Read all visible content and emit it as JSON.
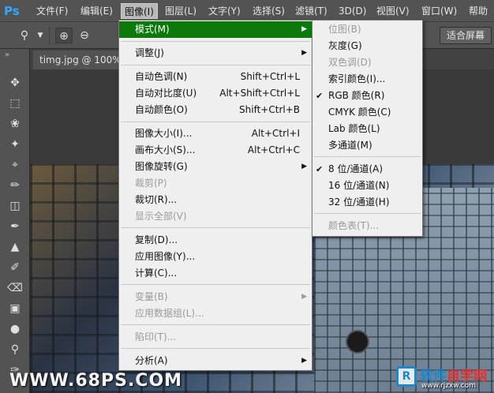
{
  "app": {
    "logo": "Ps"
  },
  "menubar": {
    "items": [
      "文件(F)",
      "编辑(E)",
      "图像(I)",
      "图层(L)",
      "文字(Y)",
      "选择(S)",
      "滤镜(T)",
      "3D(D)",
      "视图(V)",
      "窗口(W)",
      "帮助"
    ]
  },
  "options": {
    "fit_screen": "适合屏幕"
  },
  "document": {
    "tab_title": "timg.jpg @ 100%("
  },
  "image_menu": {
    "items": [
      {
        "label": "模式(M)",
        "shortcut": "",
        "submenu": true,
        "disabled": false
      },
      {
        "label": "调整(J)",
        "shortcut": "",
        "submenu": true,
        "disabled": false
      },
      {
        "label": "自动色调(N)",
        "shortcut": "Shift+Ctrl+L",
        "submenu": false,
        "disabled": false
      },
      {
        "label": "自动对比度(U)",
        "shortcut": "Alt+Shift+Ctrl+L",
        "submenu": false,
        "disabled": false
      },
      {
        "label": "自动颜色(O)",
        "shortcut": "Shift+Ctrl+B",
        "submenu": false,
        "disabled": false
      },
      {
        "label": "图像大小(I)...",
        "shortcut": "Alt+Ctrl+I",
        "submenu": false,
        "disabled": false
      },
      {
        "label": "画布大小(S)...",
        "shortcut": "Alt+Ctrl+C",
        "submenu": false,
        "disabled": false
      },
      {
        "label": "图像旋转(G)",
        "shortcut": "",
        "submenu": true,
        "disabled": false
      },
      {
        "label": "裁剪(P)",
        "shortcut": "",
        "submenu": false,
        "disabled": true
      },
      {
        "label": "裁切(R)...",
        "shortcut": "",
        "submenu": false,
        "disabled": false
      },
      {
        "label": "显示全部(V)",
        "shortcut": "",
        "submenu": false,
        "disabled": true
      },
      {
        "label": "复制(D)...",
        "shortcut": "",
        "submenu": false,
        "disabled": false
      },
      {
        "label": "应用图像(Y)...",
        "shortcut": "",
        "submenu": false,
        "disabled": false
      },
      {
        "label": "计算(C)...",
        "shortcut": "",
        "submenu": false,
        "disabled": false
      },
      {
        "label": "变量(B)",
        "shortcut": "",
        "submenu": true,
        "disabled": true
      },
      {
        "label": "应用数据组(L)...",
        "shortcut": "",
        "submenu": false,
        "disabled": true
      },
      {
        "label": "陷印(T)...",
        "shortcut": "",
        "submenu": false,
        "disabled": true
      },
      {
        "label": "分析(A)",
        "shortcut": "",
        "submenu": true,
        "disabled": false
      }
    ]
  },
  "mode_submenu": {
    "items": [
      {
        "label": "位图(B)",
        "checked": false,
        "disabled": true
      },
      {
        "label": "灰度(G)",
        "checked": false,
        "disabled": false
      },
      {
        "label": "双色调(D)",
        "checked": false,
        "disabled": true
      },
      {
        "label": "索引颜色(I)...",
        "checked": false,
        "disabled": false
      },
      {
        "label": "RGB 颜色(R)",
        "checked": true,
        "disabled": false
      },
      {
        "label": "CMYK 颜色(C)",
        "checked": false,
        "disabled": false
      },
      {
        "label": "Lab 颜色(L)",
        "checked": false,
        "disabled": false
      },
      {
        "label": "多通道(M)",
        "checked": false,
        "disabled": false
      },
      {
        "label": "8 位/通道(A)",
        "checked": true,
        "disabled": false
      },
      {
        "label": "16 位/通道(N)",
        "checked": false,
        "disabled": false
      },
      {
        "label": "32 位/通道(H)",
        "checked": false,
        "disabled": false
      },
      {
        "label": "颜色表(T)...",
        "checked": false,
        "disabled": true
      }
    ]
  },
  "watermarks": {
    "left": "WWW.68PS.COM",
    "right_logo": "软件",
    "right_title_a": "软件",
    "right_title_b": "自学网",
    "right_url": "www.rjzxw.com"
  },
  "colors": {
    "highlight": "#0b7a0b",
    "ps_blue": "#31a8ff"
  }
}
